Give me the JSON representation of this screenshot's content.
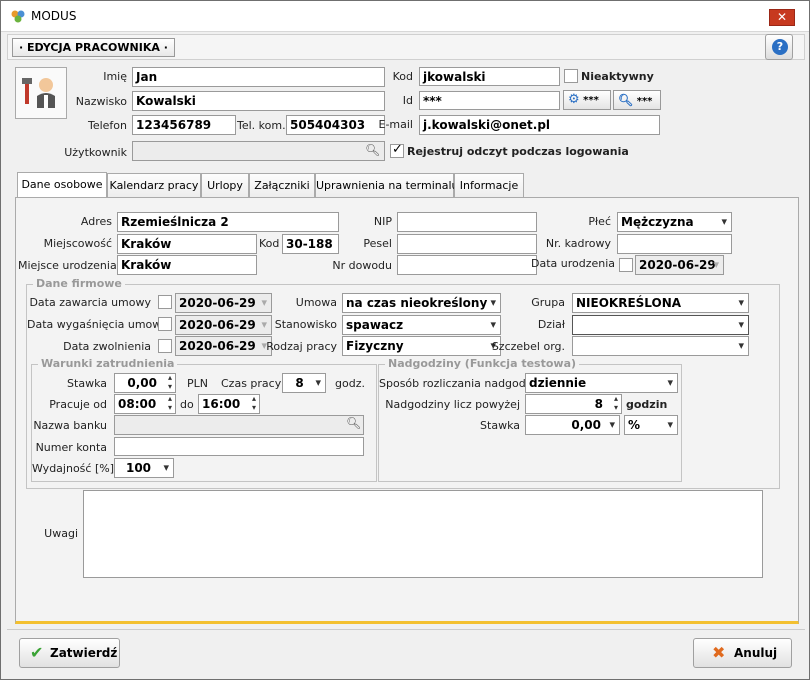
{
  "window": {
    "title": "MODUS",
    "close_label": "✕"
  },
  "header": {
    "title": "EDYCJA PRACOWNIKA",
    "help": "?"
  },
  "top": {
    "imie_label": "Imię",
    "imie": "Jan",
    "nazwisko_label": "Nazwisko",
    "nazwisko": "Kowalski",
    "telefon_label": "Telefon",
    "telefon": "123456789",
    "telkom_label": "Tel. kom.",
    "telkom": "505404303",
    "kod_label": "Kod",
    "kod": "jkowalski",
    "nieaktywny_label": "Nieaktywny",
    "id_label": "Id",
    "id": "***",
    "btn_gear": "***",
    "btn_search": "***",
    "email_label": "E-mail",
    "email": "j.kowalski@onet.pl",
    "uzytkownik_label": "Użytkownik",
    "uzytkownik": "",
    "rejestruj_label": "Rejestruj odczyt podczas logowania"
  },
  "tabs": [
    "Dane osobowe",
    "Kalendarz pracy",
    "Urlopy",
    "Załączniki",
    "Uprawnienia na terminalu",
    "Informacje"
  ],
  "personal": {
    "adres_label": "Adres",
    "adres": "Rzemieślnicza 2",
    "miejscowosc_label": "Miejscowość",
    "miejscowosc": "Kraków",
    "kod_label": "Kod",
    "kod": "30-188",
    "miejsce_ur_label": "Miejsce urodzenia",
    "miejsce_ur": "Kraków",
    "nip_label": "NIP",
    "pesel_label": "Pesel",
    "nr_dowodu_label": "Nr dowodu",
    "plec_label": "Płeć",
    "plec": "Mężczyzna",
    "nr_kadrowy_label": "Nr. kadrowy",
    "data_ur_label": "Data urodzenia",
    "data_ur": "2020-06-29"
  },
  "firm": {
    "title": "Dane firmowe",
    "zawarcia_label": "Data zawarcia umowy",
    "zawarcia": "2020-06-29",
    "wygasniecia_label": "Data wygaśnięcia umowy",
    "wygasniecia": "2020-06-29",
    "zwolnienia_label": "Data zwolnienia",
    "zwolnienia": "2020-06-29",
    "umowa_label": "Umowa",
    "umowa": "na czas nieokreślony",
    "stanowisko_label": "Stanowisko",
    "stanowisko": "spawacz",
    "rodzaj_label": "Rodzaj pracy",
    "rodzaj": "Fizyczny",
    "grupa_label": "Grupa",
    "grupa": "NIEOKREŚLONA",
    "dzial_label": "Dział",
    "dzial": "",
    "szczebel_label": "Szczebel org.",
    "szczebel": ""
  },
  "warunki": {
    "title": "Warunki zatrudnienia",
    "stawka_label": "Stawka",
    "stawka": "0,00",
    "pln": "PLN",
    "czas_label": "Czas pracy",
    "czas": "8",
    "godz": "godz.",
    "od_label": "Pracuje od",
    "od": "08:00",
    "do_label": "do",
    "do": "16:00",
    "bank_label": "Nazwa banku",
    "konto_label": "Numer konta",
    "wydajnosc_label": "Wydajność [%]",
    "wydajnosc": "100"
  },
  "nadgodziny": {
    "title": "Nadgodziny (Funkcja testowa)",
    "sposob_label": "Sposób rozliczania nadgodzin",
    "sposob": "dziennie",
    "powyzej_label": "Nadgodziny licz powyżej",
    "powyzej": "8",
    "godzin": "godzin",
    "stawka_label": "Stawka",
    "stawka": "0,00",
    "jednostka": "%"
  },
  "uwagi_label": "Uwagi",
  "footer": {
    "ok": "Zatwierdź",
    "cancel": "Anuluj"
  }
}
